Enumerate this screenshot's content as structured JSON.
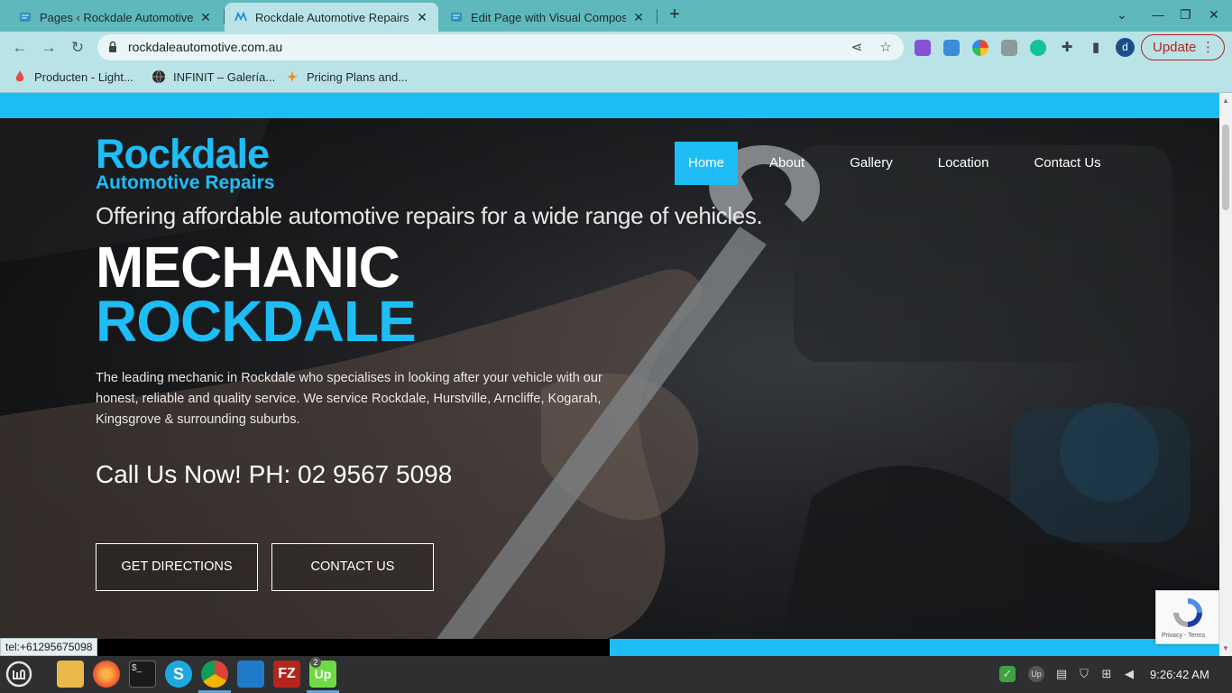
{
  "browser": {
    "tabs": [
      {
        "title": "Pages ‹ Rockdale Automotive",
        "close": "✕",
        "active": false
      },
      {
        "title": "Rockdale Automotive Repairs",
        "close": "✕",
        "active": true
      },
      {
        "title": "Edit Page with Visual Compos",
        "close": "✕",
        "active": false
      }
    ],
    "new_tab": "+",
    "url": "rockdaleautomotive.com.au",
    "profile_initial": "d",
    "update_label": "Update",
    "bookmarks": [
      {
        "label": "Producten - Light..."
      },
      {
        "label": "INFINIT – Galería..."
      },
      {
        "label": "Pricing Plans and..."
      }
    ]
  },
  "site": {
    "logo": {
      "line1": "Rockdale",
      "line2": "Automotive Repairs"
    },
    "nav": [
      "Home",
      "About",
      "Gallery",
      "Location",
      "Contact Us"
    ],
    "active_nav": "Home",
    "tagline": "Offering affordable automotive repairs for a wide range of vehicles.",
    "headline_1": "MECHANIC",
    "headline_2": "ROCKDALE",
    "intro": "The leading mechanic in Rockdale who specialises in looking after your vehicle with our honest, reliable and quality service. We service Rockdale, Hurstville, Arncliffe, Kogarah, Kingsgrove & surrounding suburbs.",
    "call": "Call Us Now! PH: 02 9567 5098",
    "cta_directions": "GET DIRECTIONS",
    "cta_contact": "CONTACT US",
    "recaptcha_links": "Privacy - Terms",
    "accent_color": "#1ebdf6"
  },
  "status_bar": {
    "link": "tel:+61295675098"
  },
  "taskbar": {
    "upwork_badge": "2",
    "clock": "9:26:42 AM"
  }
}
